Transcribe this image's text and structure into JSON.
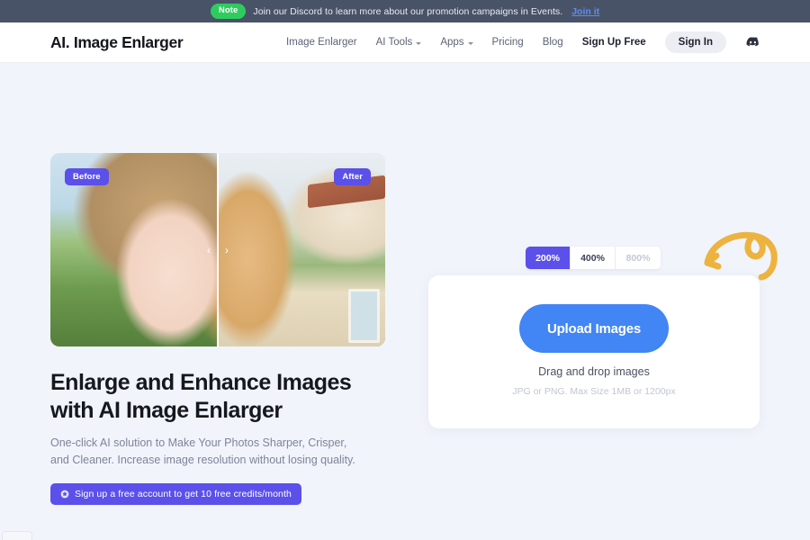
{
  "notice": {
    "badge": "Note",
    "text": "Join our Discord to learn more about our promotion campaigns in Events.",
    "link": "Join it"
  },
  "header": {
    "logo": "AI. Image Enlarger",
    "nav": [
      {
        "label": "Image Enlarger",
        "has_caret": false
      },
      {
        "label": "AI Tools",
        "has_caret": true
      },
      {
        "label": "Apps",
        "has_caret": true
      },
      {
        "label": "Pricing",
        "has_caret": false
      },
      {
        "label": "Blog",
        "has_caret": false
      }
    ],
    "sign_up": "Sign Up Free",
    "sign_in": "Sign In",
    "discord_icon": "discord-icon"
  },
  "hero": {
    "compare": {
      "before_badge": "Before",
      "after_badge": "After",
      "prev_chevron": "‹",
      "next_chevron": "›"
    },
    "headline_line1": "Enlarge and Enhance Images",
    "headline_line2": "with AI Image Enlarger",
    "subhead": "One-click AI solution to Make Your Photos Sharper, Crisper, and Cleaner. Increase image resolution without losing quality.",
    "credit_button": "Sign up a free account to get 10 free credits/month",
    "credit_icon": "gift-icon"
  },
  "uploader": {
    "scales": [
      {
        "label": "200%",
        "state": "active"
      },
      {
        "label": "400%",
        "state": "normal"
      },
      {
        "label": "800%",
        "state": "disabled"
      }
    ],
    "upload_button": "Upload Images",
    "drag_text": "Drag and drop images",
    "hint_text": "JPG or PNG. Max Size 1MB or 1200px",
    "arrow_annotation": "curved-arrow-icon"
  },
  "colors": {
    "page_bg": "#f1f4fb",
    "notice_bg": "#495368",
    "notice_badge": "#2ecc5f",
    "notice_link": "#5b8ef5",
    "purple": "#5b50ea",
    "blue": "#4285f4",
    "arrow_amber": "#edb340",
    "text_dark": "#16181f",
    "text_muted": "#7d8599"
  }
}
